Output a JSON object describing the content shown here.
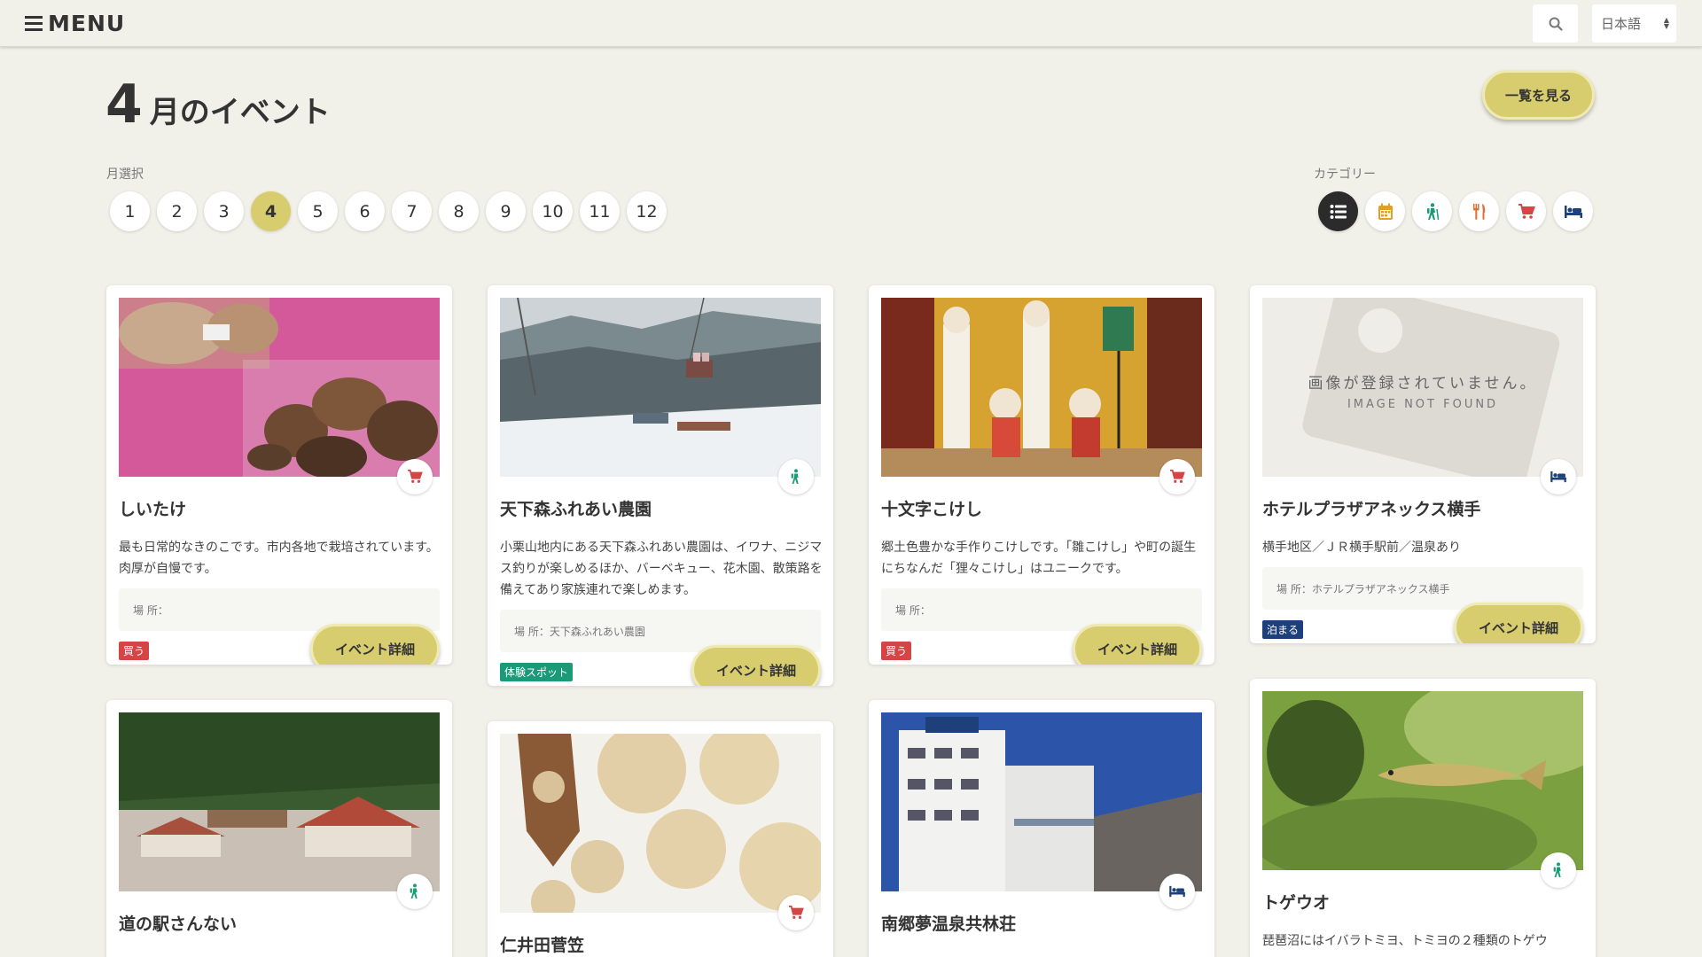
{
  "header": {
    "menu_label": "MENU",
    "language": "日本語"
  },
  "page": {
    "month_num": "4",
    "title_suffix": "月のイベント",
    "list_button": "一覧を見る",
    "month_label": "月選択",
    "category_label": "カテゴリー",
    "months": [
      "1",
      "2",
      "3",
      "4",
      "5",
      "6",
      "7",
      "8",
      "9",
      "10",
      "11",
      "12"
    ],
    "active_month": "4"
  },
  "categories": [
    {
      "name": "list-icon",
      "color": "#ffffff",
      "active": true
    },
    {
      "name": "calendar-icon",
      "color": "#e0a020"
    },
    {
      "name": "hiking-icon",
      "color": "#1a9a78"
    },
    {
      "name": "fork-knife-icon",
      "color": "#e07030"
    },
    {
      "name": "cart-icon",
      "color": "#d64545"
    },
    {
      "name": "bed-icon",
      "color": "#1d3f7a"
    }
  ],
  "cards": [
    {
      "title": "しいたけ",
      "desc": "最も日常的なきのこです。市内各地で栽培されています。肉厚が自慢です。",
      "place": "場 所：",
      "tag": "買う",
      "tag_color": "#d64545",
      "category_icon": "cart-icon",
      "detail": "イベント詳細"
    },
    {
      "title": "天下森ふれあい農園",
      "desc": "小栗山地内にある天下森ふれあい農園は、イワナ、ニジマス釣りが楽しめるほか、バーベキュー、花木園、散策路を備えてあり家族連れで楽しめます。",
      "place": "場 所：天下森ふれあい農園",
      "tag": "体験スポット",
      "tag_color": "#1a9a78",
      "category_icon": "hiking-icon",
      "detail": "イベント詳細"
    },
    {
      "title": "十文字こけし",
      "desc": "郷土色豊かな手作りこけしです。「雛こけし」や町の誕生にちなんだ「狸々こけし」はユニークです。",
      "place": "場 所：",
      "tag": "買う",
      "tag_color": "#d64545",
      "category_icon": "cart-icon",
      "detail": "イベント詳細"
    },
    {
      "title": "ホテルプラザアネックス横手",
      "desc": "横手地区／ＪＲ横手駅前／温泉あり",
      "place": "場 所：ホテルプラザアネックス横手",
      "tag": "泊まる",
      "tag_color": "#1d3f7a",
      "category_icon": "bed-icon",
      "detail": "イベント詳細",
      "no_image_jp": "画像が登録されていません。",
      "no_image_en": "IMAGE NOT FOUND"
    },
    {
      "title": "道の駅さんない",
      "category_icon": "hiking-icon"
    },
    {
      "title": "仁井田菅笠",
      "category_icon": "cart-icon"
    },
    {
      "title": "南郷夢温泉共林荘",
      "category_icon": "bed-icon"
    },
    {
      "title": "トゲウオ",
      "desc": "琵琶沼にはイバラトミヨ、トミヨの２種類のトゲウ",
      "category_icon": "hiking-icon"
    }
  ]
}
